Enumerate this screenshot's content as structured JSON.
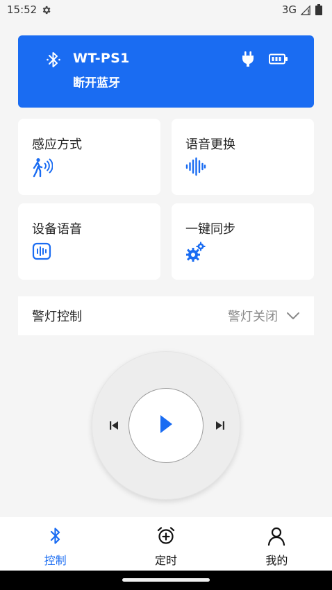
{
  "status_bar": {
    "time": "15:52",
    "network": "3G",
    "icons": [
      "gear-icon",
      "signal-icon",
      "battery-icon"
    ]
  },
  "device": {
    "name": "WT-PS1",
    "disconnect_label": "断开蓝牙",
    "icons": [
      "bluetooth-icon",
      "plug-icon",
      "battery-icon"
    ]
  },
  "features": [
    {
      "label": "感应方式",
      "icon": "motion-sensor-icon"
    },
    {
      "label": "语音更换",
      "icon": "sound-wave-icon"
    },
    {
      "label": "设备语音",
      "icon": "voice-waveform-icon"
    },
    {
      "label": "一键同步",
      "icon": "gears-icon"
    }
  ],
  "warning_light": {
    "label": "警灯控制",
    "value": "警灯关闭"
  },
  "player": {
    "icons": [
      "previous-icon",
      "play-icon",
      "next-icon"
    ]
  },
  "bottom_nav": {
    "items": [
      {
        "label": "控制",
        "icon": "bluetooth-icon",
        "active": true
      },
      {
        "label": "定时",
        "icon": "alarm-clock-icon",
        "active": false
      },
      {
        "label": "我的",
        "icon": "user-icon",
        "active": false
      }
    ]
  },
  "colors": {
    "accent": "#1a6cf2",
    "background": "#f5f5f5",
    "card": "#ffffff",
    "muted_text": "#8a8a8a"
  }
}
